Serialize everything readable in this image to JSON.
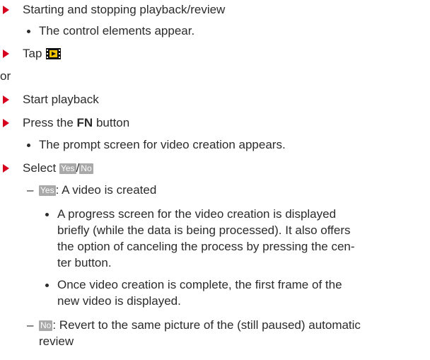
{
  "steps": {
    "start_stop": "Starting and stopping playback/review",
    "controls_appear": "The control elements appear.",
    "tap_label": "Tap",
    "or": "or",
    "start_playback": "Start playback",
    "press_prefix": "Press the",
    "fn_label": "FN",
    "press_suffix": "button",
    "prompt_appears": "The prompt screen for video creation appears.",
    "select_label": "Select",
    "yes_chip": "Yes",
    "slash": "/",
    "no_chip": "No",
    "yes_desc": ": A video is created",
    "progress_line1": "A progress screen for the video creation is displayed",
    "progress_line2": "briefly (while the data is being processed). It also offers",
    "progress_line3": "the option of canceling the process by pressing the cen-",
    "progress_line4": "ter button.",
    "complete_line1": "Once video creation is complete, the first frame of the",
    "complete_line2": "new video is displayed.",
    "no_desc_line1": ": Revert to the same picture of the (still paused) automatic",
    "no_desc_line2": "review"
  },
  "icons": {
    "arrow": "red-triangle-arrow-icon",
    "video_button": "video-play-button-icon"
  },
  "colors": {
    "arrow": "#d8001f",
    "chip_bg": "#a9a9a9",
    "text": "#2b2b2b"
  }
}
